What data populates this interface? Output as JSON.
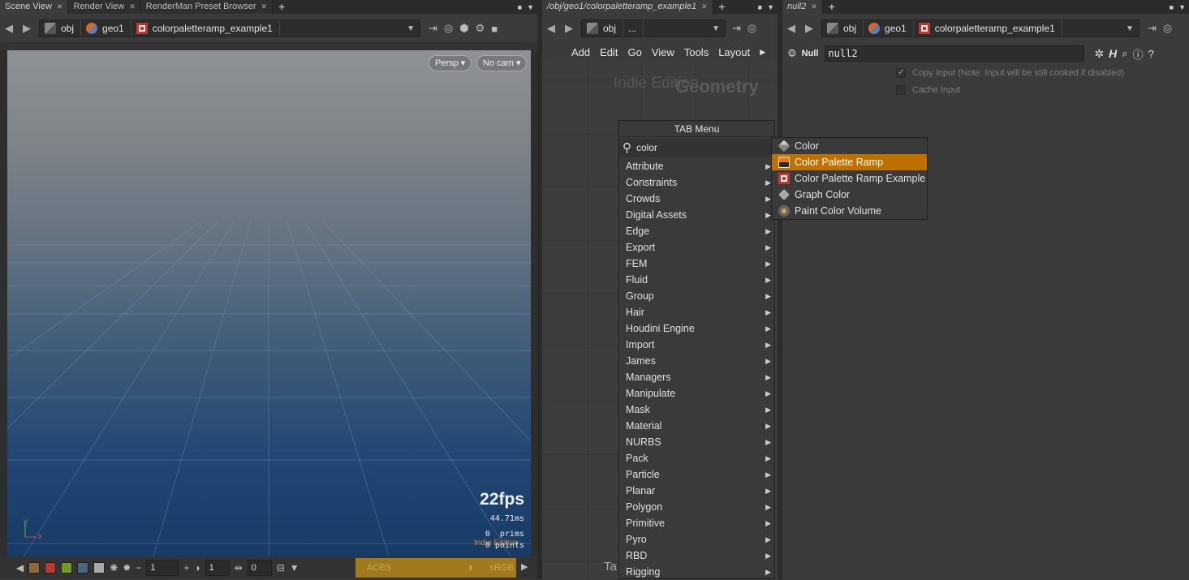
{
  "left_pane": {
    "tabs": [
      {
        "label": "Scene View"
      },
      {
        "label": "Render View"
      },
      {
        "label": "RenderMan Preset Browser"
      }
    ],
    "path": [
      "obj",
      "geo1",
      "colorpaletteramp_example1"
    ],
    "viewport": {
      "camera_mode": "Persp",
      "camera": "No cam",
      "fps": "22fps",
      "ms": "44.71ms",
      "prims": "0  prims",
      "points": "0 points",
      "indie": "Indie Edition",
      "axis_y": "y",
      "axis_x": "x"
    },
    "bottom": {
      "field1": "1",
      "field2": "1",
      "field3": "0",
      "color_space": "ACES",
      "display": "sRGB"
    }
  },
  "mid_pane": {
    "tab_label": "/obj/geo1/colorpaletteramp_example1",
    "path": [
      "obj",
      "..."
    ],
    "menu": [
      "Add",
      "Edit",
      "Go",
      "View",
      "Tools",
      "Layout"
    ],
    "watermark_indie": "Indie Edition",
    "watermark_type": "Geometry",
    "bottom_text": "Ta"
  },
  "tab_menu": {
    "title": "TAB Menu",
    "search_value": "color",
    "items": [
      "Attribute",
      "Constraints",
      "Crowds",
      "Digital Assets",
      "Edge",
      "Export",
      "FEM",
      "Fluid",
      "Group",
      "Hair",
      "Houdini Engine",
      "Import",
      "James",
      "Managers",
      "Manipulate",
      "Mask",
      "Material",
      "NURBS",
      "Pack",
      "Particle",
      "Planar",
      "Polygon",
      "Primitive",
      "Pyro",
      "RBD",
      "Rigging"
    ],
    "results": [
      {
        "label": "Color",
        "icon": "color-node-icon",
        "selected": false
      },
      {
        "label": "Color Palette Ramp",
        "icon": "palette-ramp-icon",
        "selected": true
      },
      {
        "label": "Color Palette Ramp Example",
        "icon": "gift-icon",
        "selected": false
      },
      {
        "label": "Graph Color",
        "icon": "graph-color-icon",
        "selected": false
      },
      {
        "label": "Paint Color Volume",
        "icon": "paint-volume-icon",
        "selected": false
      }
    ],
    "highlight_color": "#c07000"
  },
  "right_pane": {
    "tab_label": "null2",
    "path": [
      "obj",
      "geo1",
      "colorpaletteramp_example1"
    ],
    "node_type": "Null",
    "node_name": "null2",
    "parms": [
      {
        "label": "Copy Input (Note: Input will be still cooked if disabled)",
        "checked": true
      },
      {
        "label": "Cache Input",
        "checked": false
      }
    ]
  }
}
